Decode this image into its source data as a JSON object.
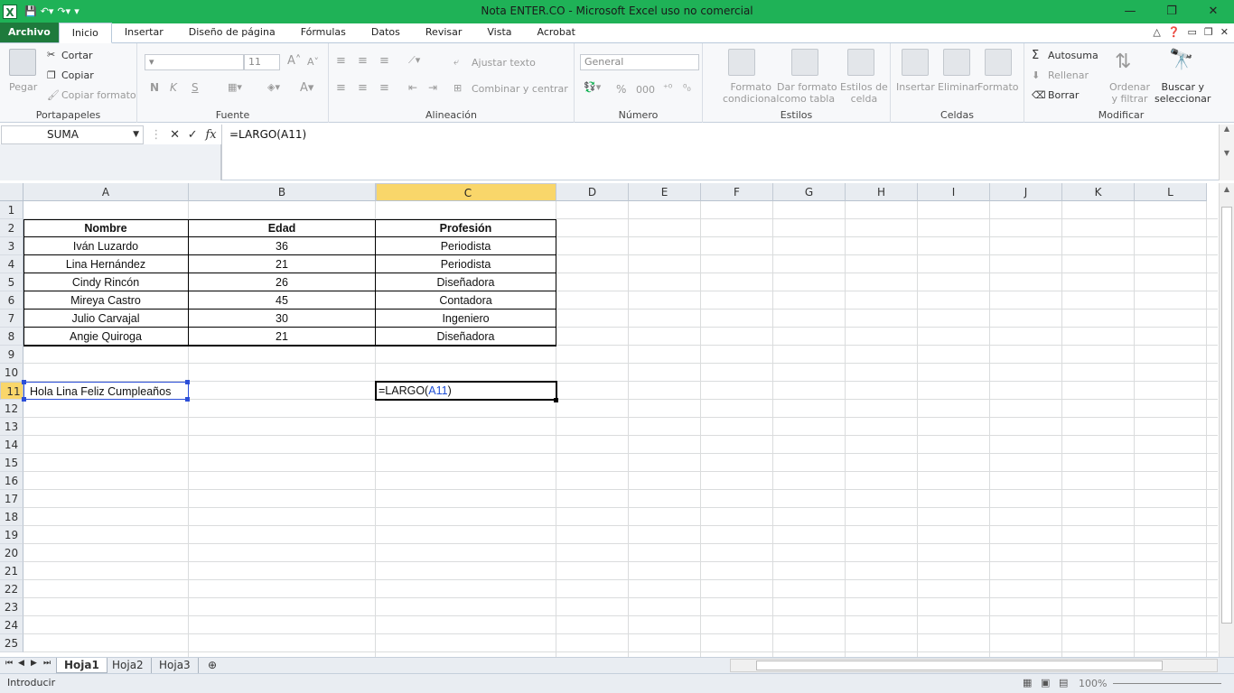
{
  "window": {
    "title": "Nota ENTER.CO  -  Microsoft Excel uso no comercial",
    "app_icon": "X",
    "controls": {
      "minimize": "—",
      "restore": "❐",
      "close": "✕"
    }
  },
  "tabs": [
    "Archivo",
    "Inicio",
    "Insertar",
    "Diseño de página",
    "Fórmulas",
    "Datos",
    "Revisar",
    "Vista",
    "Acrobat"
  ],
  "ribbon": {
    "portapapeles": {
      "label": "Portapapeles",
      "pegar": "Pegar",
      "cortar": "Cortar",
      "copiar": "Copiar",
      "copiar_formato": "Copiar formato"
    },
    "fuente": {
      "label": "Fuente",
      "size": "11",
      "bold": "N",
      "italic": "K",
      "underline": "S"
    },
    "alineacion": {
      "label": "Alineación",
      "ajustar": "Ajustar texto",
      "combinar": "Combinar y centrar"
    },
    "numero": {
      "label": "Número",
      "format": "General",
      "percent": "%",
      "thousands": "000"
    },
    "estilos": {
      "label": "Estilos",
      "formato_condicional": [
        "Formato",
        "condicional"
      ],
      "dar_formato": [
        "Dar formato",
        "como tabla"
      ],
      "estilos_celda": [
        "Estilos de",
        "celda"
      ]
    },
    "celdas": {
      "label": "Celdas",
      "insertar": "Insertar",
      "eliminar": "Eliminar",
      "formato": "Formato"
    },
    "modificar": {
      "label": "Modificar",
      "autosuma": "Autosuma",
      "rellenar": "Rellenar",
      "borrar": "Borrar",
      "ordenar": [
        "Ordenar",
        "y filtrar"
      ],
      "buscar": [
        "Buscar y",
        "seleccionar"
      ]
    }
  },
  "formula_bar": {
    "name_box": "SUMA",
    "formula": "=LARGO(A11)",
    "fx": "fx"
  },
  "columns": [
    "A",
    "B",
    "C",
    "D",
    "E",
    "F",
    "G",
    "H",
    "I",
    "J",
    "K",
    "L"
  ],
  "rows": [
    "1",
    "2",
    "3",
    "4",
    "5",
    "6",
    "7",
    "8",
    "9",
    "10",
    "11",
    "12",
    "13",
    "14",
    "15",
    "16",
    "17",
    "18",
    "19",
    "20",
    "21",
    "22",
    "23",
    "24",
    "25"
  ],
  "table": {
    "headers": [
      "Nombre",
      "Edad",
      "Profesión"
    ],
    "data": [
      [
        "Iván Luzardo",
        "36",
        "Periodista"
      ],
      [
        "Lina Hernández",
        "21",
        "Periodista"
      ],
      [
        "Cindy Rincón",
        "26",
        "Diseñadora"
      ],
      [
        "Mireya Castro",
        "45",
        "Contadora"
      ],
      [
        "Julio Carvajal",
        "30",
        "Ingeniero"
      ],
      [
        "Angie Quiroga",
        "21",
        "Diseñadora"
      ]
    ]
  },
  "cells": {
    "a11": "Hola Lina Feliz Cumpleaños",
    "c11_prefix": "=LARGO(",
    "c11_ref": "A11",
    "c11_suffix": ")"
  },
  "sheets": [
    "Hoja1",
    "Hoja2",
    "Hoja3"
  ],
  "status": {
    "mode": "Introducir",
    "zoom": "100%"
  },
  "colors": {
    "title_green": "#1fb257",
    "file_tab": "#1e7a3c",
    "selected_header": "#f9d66a",
    "ref_blue": "#1f4fd6"
  }
}
